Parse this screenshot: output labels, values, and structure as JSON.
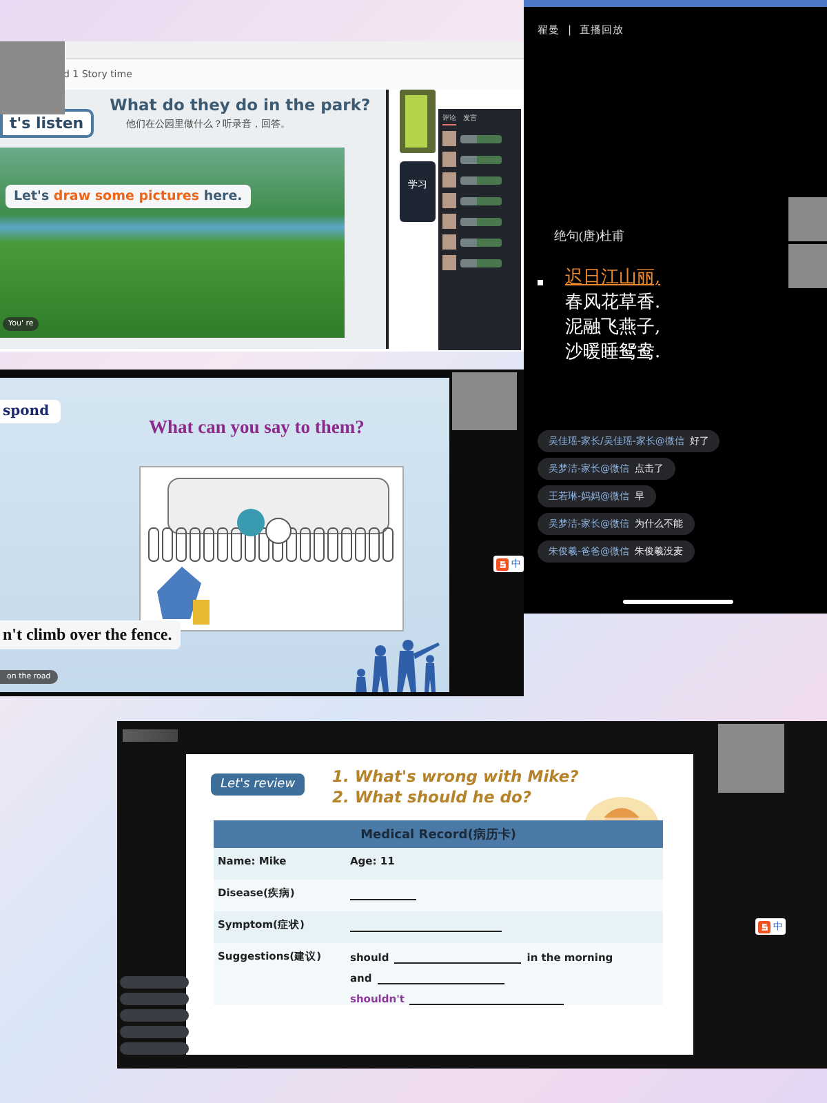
{
  "park_lesson": {
    "breadcrumb": "d 1 Story time",
    "tag": "t's listen",
    "title": "What do they do in the park?",
    "subtitle": "他们在公园里做什么？听录音，回答。",
    "speech": [
      {
        "text": "Let's ",
        "highlighted": false
      },
      {
        "text": "draw some pictures",
        "highlighted": true
      },
      {
        "text": " here.",
        "highlighted": false
      }
    ],
    "caption": "You' re",
    "side_tabs": [
      {
        "label": "评论",
        "selected": true
      },
      {
        "label": "发言",
        "selected": false
      }
    ],
    "side_button": "学习"
  },
  "poem_replay": {
    "host": "翟曼",
    "separator": "|",
    "mode": "直播回放",
    "poem_title": "绝句(唐)杜甫",
    "lines": [
      {
        "text": "迟日江山丽,",
        "highlighted": true
      },
      {
        "text": "春风花草香.",
        "highlighted": false
      },
      {
        "text": "泥融飞燕子,",
        "highlighted": false
      },
      {
        "text": "沙暖睡鸳鸯.",
        "highlighted": false
      }
    ],
    "comments": [
      {
        "user": "吴佳瑶-家长/吴佳瑶-家长@微信",
        "message": "好了"
      },
      {
        "user": "吴梦洁-家长@微信",
        "message": "点击了"
      },
      {
        "user": "王若琳-妈妈@微信",
        "message": "早"
      },
      {
        "user": "吴梦洁-家长@微信",
        "message": "为什么不能"
      },
      {
        "user": "朱俊羲-爸爸@微信",
        "message": "朱俊羲没麦"
      }
    ]
  },
  "fence_lesson": {
    "tag": "spond",
    "question": "What can you say to them?",
    "answer": "n't climb over the fence.",
    "caption": "on the road",
    "ime": "中"
  },
  "medical_lesson": {
    "tag": "Let's review",
    "questions": [
      "1. What's wrong with Mike?",
      "2. What should he do?"
    ],
    "table_title": "Medical Record(病历卡)",
    "rows": [
      {
        "kind": "text",
        "label": "Name: Mike",
        "value": "Age: 11"
      },
      {
        "kind": "short",
        "label": "Disease(疾病)"
      },
      {
        "kind": "long",
        "label": "Symptom(症状)"
      },
      {
        "kind": "suggest",
        "label": "Suggestions(建议)",
        "parts": [
          "should",
          "in the morning",
          "and",
          "shouldn't"
        ]
      }
    ],
    "ime": "中"
  }
}
